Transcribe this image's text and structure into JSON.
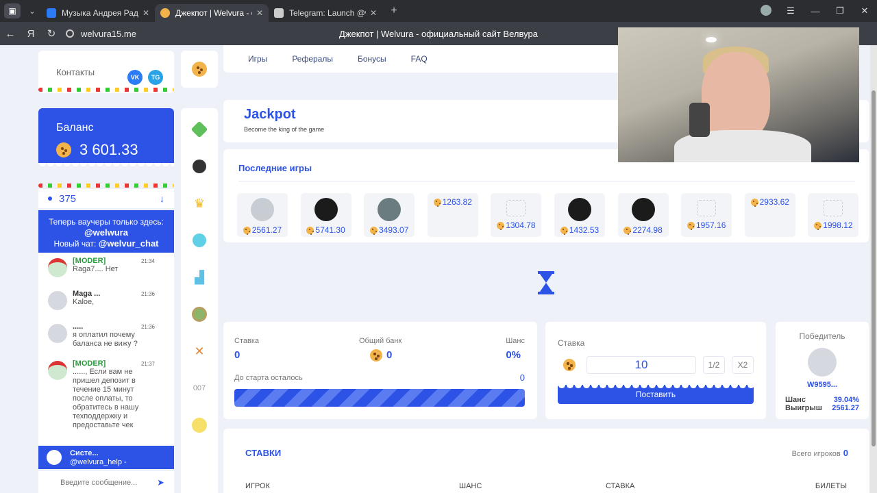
{
  "browser": {
    "tabs": [
      {
        "title": "Музыка Андрея Рад",
        "active": false,
        "favicon_color": "#2a7bf5"
      },
      {
        "title": "Джекпот | Welvura - оф",
        "active": true,
        "favicon_color": "#f2b34a"
      },
      {
        "title": "Telegram: Launch @welvu",
        "active": false,
        "favicon_color": "#cccccc"
      }
    ],
    "url": "welvura15.me",
    "page_title": "Джекпот | Welvura - официальный сайт Велвура"
  },
  "contacts": {
    "label": "Контакты",
    "vk": "VK",
    "tg": "TG"
  },
  "balance": {
    "label": "Баланс",
    "value": "3 601.33"
  },
  "online": {
    "count": "375"
  },
  "promo": {
    "line1": "Теперь ваучеры только здесь:",
    "handle1": "@welwura",
    "line2": "Новый чат:",
    "handle2": "@welvur_chat"
  },
  "chat": {
    "messages": [
      {
        "name": "[MODER]",
        "mod": true,
        "text": "Raga7.... Нет",
        "time": "21:34"
      },
      {
        "name": "Maga ...",
        "mod": false,
        "text": "Kaloe,",
        "time": "21:36"
      },
      {
        "name": ".....",
        "mod": false,
        "text": "я оплатил почему баланса не вижу ?",
        "time": "21:36"
      },
      {
        "name": "[MODER]",
        "mod": true,
        "text": "......, Если вам не пришел депозит в течение 15 минут после оплаты, то обратитесь в нашу техподдержку и предоставьте чек",
        "time": "21:37"
      }
    ],
    "system_name": "Систе...",
    "system_text": "@welvura_help -",
    "input_placeholder": "Введите сообщение..."
  },
  "nav": {
    "items": [
      "Игры",
      "Рефералы",
      "Бонусы",
      "FAQ"
    ]
  },
  "jackpot": {
    "title": "Jackpot",
    "subtitle": "Become the king of the game"
  },
  "recent_games": {
    "title": "Последние игры",
    "items": [
      {
        "amount": "2561.27",
        "avatar": "default"
      },
      {
        "amount": "5741.30",
        "avatar": "dark"
      },
      {
        "amount": "3493.07",
        "avatar": "car"
      },
      {
        "amount": "1263.82",
        "avatar": "cam"
      },
      {
        "amount": "1304.78",
        "avatar": "broken"
      },
      {
        "amount": "1432.53",
        "avatar": "dark"
      },
      {
        "amount": "2274.98",
        "avatar": "dark"
      },
      {
        "amount": "1957.16",
        "avatar": "broken"
      },
      {
        "amount": "2933.62",
        "avatar": "cam"
      },
      {
        "amount": "1998.12",
        "avatar": "broken"
      }
    ]
  },
  "stats": {
    "bet_label": "Ставка",
    "bet_value": "0",
    "bank_label": "Общий банк",
    "bank_value": "0",
    "chance_label": "Шанс",
    "chance_value": "0%",
    "countdown_label": "До старта осталось",
    "countdown_value": "0"
  },
  "bet_form": {
    "label": "Ставка",
    "amount": "10",
    "half_label": "1/2",
    "double_label": "X2",
    "place_label": "Поставить"
  },
  "winner": {
    "title": "Победитель",
    "name": "W9595...",
    "chance_label": "Шанс",
    "chance_value": "39.04%",
    "win_label": "Выигрыш",
    "win_value": "2561.27"
  },
  "bets_table": {
    "title": "СТАВКИ",
    "total_label": "Всего игроков",
    "total_value": "0",
    "columns": [
      "ИГРОК",
      "ШАНС",
      "СТАВКА",
      "БИЛЕТЫ"
    ]
  },
  "colors": {
    "accent": "#2c53e6",
    "moderator": "#2a9b3b",
    "page_bg": "#eef2f8"
  }
}
